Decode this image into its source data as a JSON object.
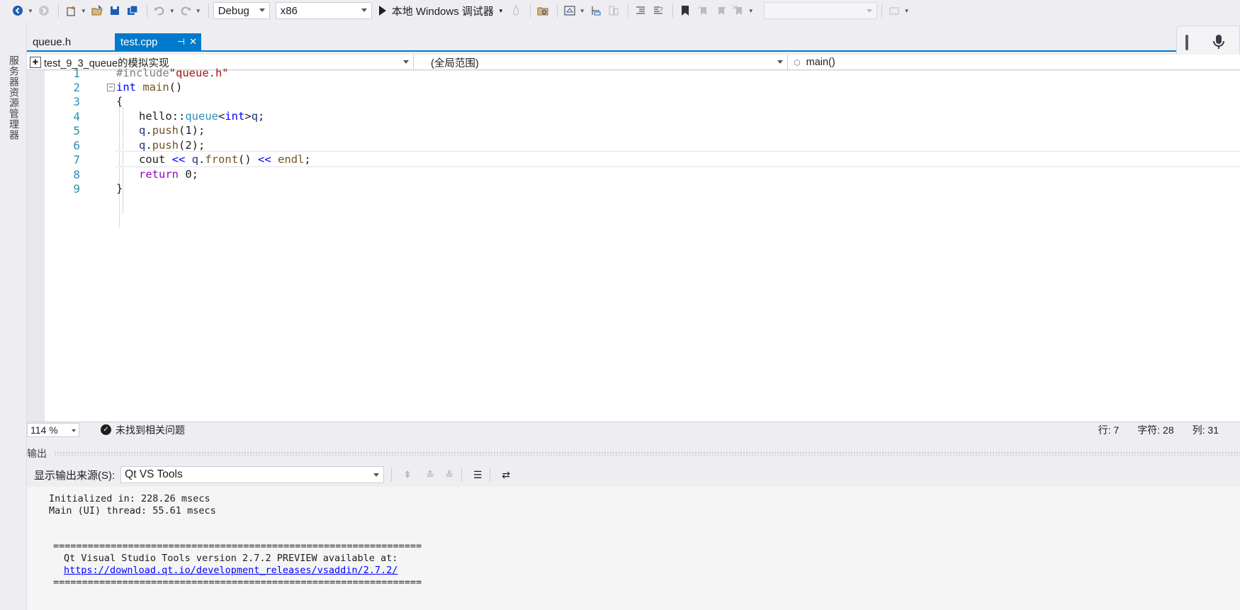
{
  "toolbar": {
    "config": "Debug",
    "platform": "x86",
    "run_label": "本地 Windows 调试器"
  },
  "side_tab": {
    "label": "服务器资源管理器"
  },
  "tabs": [
    {
      "label": "queue.h",
      "active": false
    },
    {
      "label": "test.cpp",
      "active": true
    }
  ],
  "navbar": {
    "project": "test_9_3_queue的模拟实现",
    "scope": "(全局范围)",
    "member": "main()"
  },
  "editor": {
    "line_numbers": [
      "1",
      "2",
      "3",
      "4",
      "5",
      "6",
      "7",
      "8",
      "9"
    ],
    "lines": [
      "#include\"queue.h\"",
      "int main()",
      "{",
      "hello::queue<int>q;",
      "q.push(1);",
      "q.push(2);",
      "cout << q.front() << endl;",
      "return 0;",
      "}"
    ],
    "current_line": 7
  },
  "status": {
    "zoom": "114 %",
    "issues": "未找到相关问题",
    "line": "行: 7",
    "char": "字符: 28",
    "col": "列: 31"
  },
  "output": {
    "title": "输出",
    "source_label": "显示输出来源(S):",
    "source_value": "Qt VS Tools",
    "lines": [
      "Initialized in: 228.26 msecs",
      "Main (UI) thread: 55.61 msecs",
      "================================================================",
      "Qt Visual Studio Tools version 2.7.2 PREVIEW available at:",
      "https://download.qt.io/development_releases/vsaddin/2.7.2/",
      "================================================================"
    ]
  }
}
